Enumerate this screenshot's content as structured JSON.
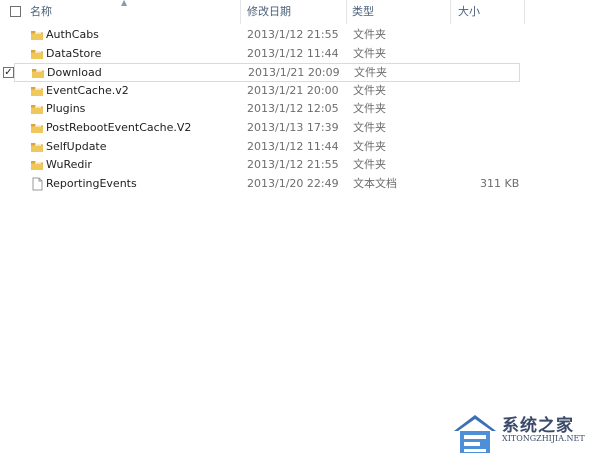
{
  "header": {
    "name": "名称",
    "date_modified": "修改日期",
    "type": "类型",
    "size": "大小"
  },
  "files": [
    {
      "name": "AuthCabs",
      "date": "2013/1/12 21:55",
      "type": "文件夹",
      "size": "",
      "icon": "folder-icon",
      "selected": false
    },
    {
      "name": "DataStore",
      "date": "2013/1/12 11:44",
      "type": "文件夹",
      "size": "",
      "icon": "folder-icon",
      "selected": false
    },
    {
      "name": "Download",
      "date": "2013/1/21 20:09",
      "type": "文件夹",
      "size": "",
      "icon": "folder-icon",
      "selected": true
    },
    {
      "name": "EventCache.v2",
      "date": "2013/1/21 20:00",
      "type": "文件夹",
      "size": "",
      "icon": "folder-icon",
      "selected": false
    },
    {
      "name": "Plugins",
      "date": "2013/1/12 12:05",
      "type": "文件夹",
      "size": "",
      "icon": "folder-icon",
      "selected": false
    },
    {
      "name": "PostRebootEventCache.V2",
      "date": "2013/1/13 17:39",
      "type": "文件夹",
      "size": "",
      "icon": "folder-icon",
      "selected": false
    },
    {
      "name": "SelfUpdate",
      "date": "2013/1/12 11:44",
      "type": "文件夹",
      "size": "",
      "icon": "folder-icon",
      "selected": false
    },
    {
      "name": "WuRedir",
      "date": "2013/1/12 21:55",
      "type": "文件夹",
      "size": "",
      "icon": "folder-icon",
      "selected": false
    },
    {
      "name": "ReportingEvents",
      "date": "2013/1/20 22:49",
      "type": "文本文档",
      "size": "311 KB",
      "icon": "text-document-icon",
      "selected": false
    }
  ],
  "watermark": {
    "title": "系统之家",
    "subtitle": "XITONGZHIJIA.NET"
  },
  "colors": {
    "folder": "#e8b84a",
    "header_text": "#4c607a",
    "secondary_text": "#6d6d6d"
  }
}
